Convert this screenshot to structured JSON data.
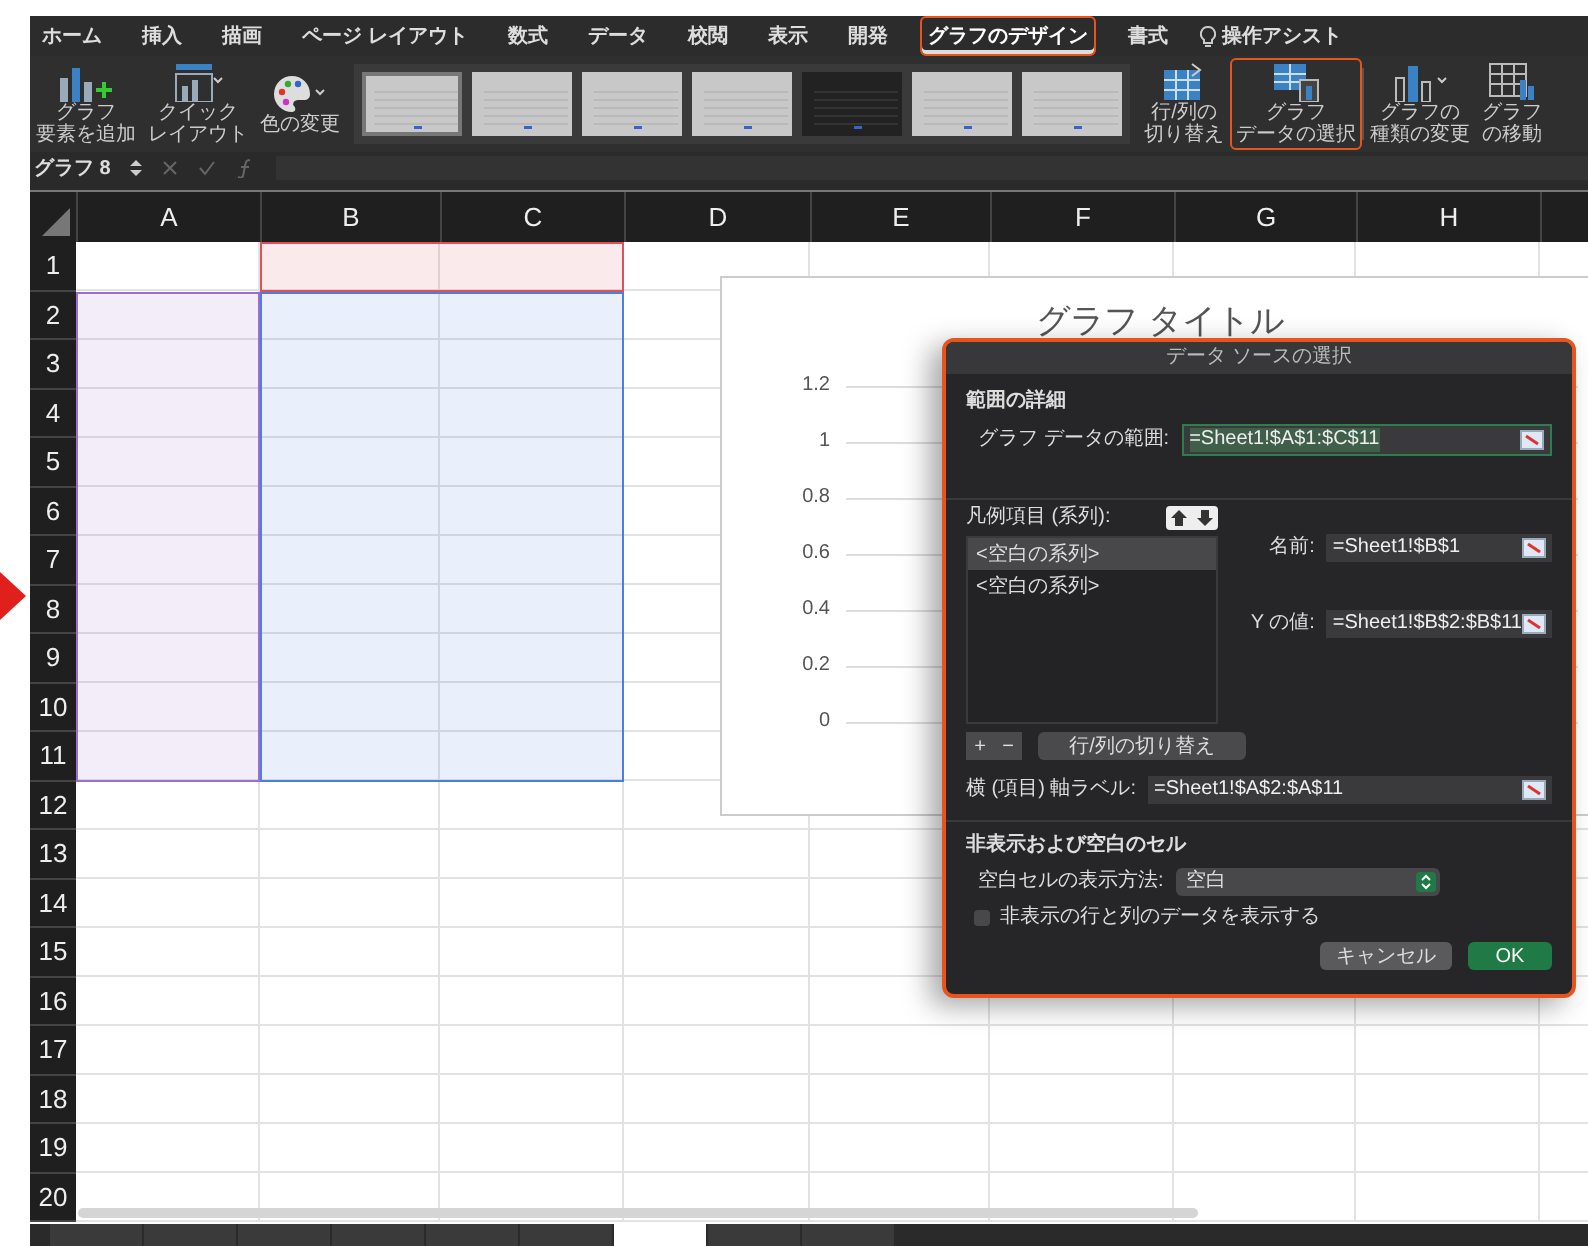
{
  "menu_tabs": [
    {
      "label": "ホーム",
      "selected": false,
      "marked": false
    },
    {
      "label": "挿入",
      "selected": false,
      "marked": false
    },
    {
      "label": "描画",
      "selected": false,
      "marked": false
    },
    {
      "label": "ページ レイアウト",
      "selected": false,
      "marked": false
    },
    {
      "label": "数式",
      "selected": false,
      "marked": false
    },
    {
      "label": "データ",
      "selected": false,
      "marked": false
    },
    {
      "label": "校閲",
      "selected": false,
      "marked": false
    },
    {
      "label": "表示",
      "selected": false,
      "marked": false
    },
    {
      "label": "開発",
      "selected": false,
      "marked": false
    },
    {
      "label": "グラフのデザイン",
      "selected": true,
      "marked": true
    },
    {
      "label": "書式",
      "selected": false,
      "marked": false
    }
  ],
  "assist": {
    "label": "操作アシスト"
  },
  "ribbon_left": [
    {
      "kind": "add_element",
      "lines": [
        "グラフ",
        "要素を追加"
      ]
    },
    {
      "kind": "quick_layout",
      "lines": [
        "クイック",
        "レイアウト"
      ]
    },
    {
      "kind": "colors",
      "lines": [
        "色の変更"
      ]
    }
  ],
  "styles": [
    {
      "selected": true,
      "dark": false
    },
    {
      "selected": false,
      "dark": false
    },
    {
      "selected": false,
      "dark": false
    },
    {
      "selected": false,
      "dark": false
    },
    {
      "selected": false,
      "dark": true
    },
    {
      "selected": false,
      "dark": false
    },
    {
      "selected": false,
      "dark": false
    }
  ],
  "ribbon_right": [
    {
      "kind": "switch",
      "lines": [
        "行/列の",
        "切り替え"
      ],
      "marked": false
    },
    {
      "kind": "select_data",
      "lines": [
        "グラフ",
        "データの選択"
      ],
      "marked": true
    },
    {
      "kind": "change_type",
      "lines": [
        "グラフの",
        "種類の変更"
      ],
      "marked": false
    },
    {
      "kind": "move",
      "lines": [
        "グラフ",
        "の移動"
      ],
      "marked": false
    }
  ],
  "formula_bar": {
    "name_box": "グラフ 8"
  },
  "columns": [
    "A",
    "B",
    "C",
    "D",
    "E",
    "F",
    "G",
    "H"
  ],
  "rows": [
    "1",
    "2",
    "3",
    "4",
    "5",
    "6",
    "7",
    "8",
    "9",
    "10",
    "11",
    "12",
    "13",
    "14",
    "15",
    "16",
    "17",
    "18",
    "19",
    "20"
  ],
  "highlights": [
    {
      "kind": "series_name",
      "color": "#e0505c"
    },
    {
      "kind": "category",
      "color": "#9a6fd0"
    },
    {
      "kind": "values",
      "color": "#4a7fe0"
    }
  ],
  "chart": {
    "title": "グラフ タイトル",
    "y_axis_labels": [
      "1.2",
      "1",
      "0.8",
      "0.6",
      "0.4",
      "0.2",
      "0"
    ]
  },
  "dialog": {
    "title": "データ ソースの選択",
    "range_section": "範囲の詳細",
    "range_label": "グラフ データの範囲:",
    "range_value": "=Sheet1!$A$1:$C$11",
    "legend_label": "凡例項目 (系列):",
    "series": [
      {
        "label": "<空白の系列>",
        "selected": true
      },
      {
        "label": "<空白の系列>",
        "selected": false
      }
    ],
    "name_label": "名前:",
    "name_value": "=Sheet1!$B$1",
    "values_label": "Y の値:",
    "values_value": "=Sheet1!$B$2:$B$11",
    "add": "+",
    "remove": "−",
    "switch_button": "行/列の切り替え",
    "axis_label": "横 (項目) 軸ラベル:",
    "axis_value": "=Sheet1!$A$2:$A$11",
    "hidden_section": "非表示および空白のセル",
    "empty_label": "空白セルの表示方法:",
    "empty_value": "空白",
    "show_hidden": {
      "label": "非表示の行と列のデータを表示する",
      "checked": false
    },
    "cancel": "キャンセル",
    "ok": "OK"
  },
  "sheet_tabs": [
    {
      "selected": false
    },
    {
      "selected": false
    },
    {
      "selected": false
    },
    {
      "selected": false
    },
    {
      "selected": false
    },
    {
      "selected": false
    },
    {
      "selected": true
    },
    {
      "selected": false
    },
    {
      "selected": false
    }
  ]
}
